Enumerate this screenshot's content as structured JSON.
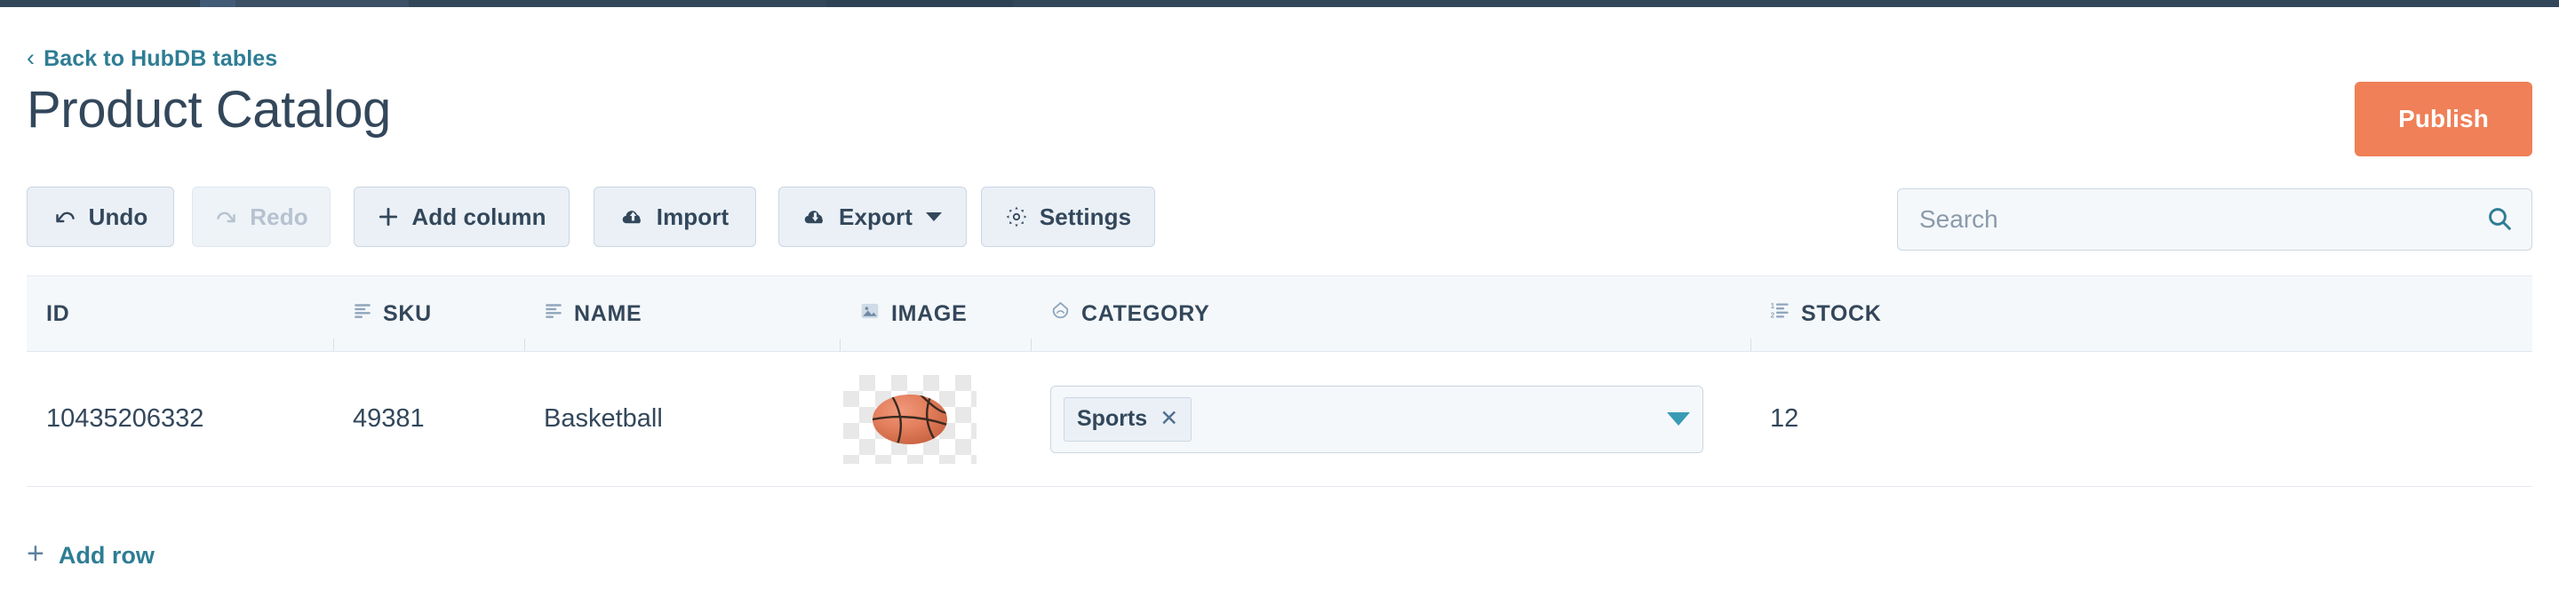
{
  "app": {
    "back_link": "Back to HubDB tables",
    "page_title": "Product Catalog",
    "publish_label": "Publish"
  },
  "colors": {
    "accent_link": "#2e7d94",
    "publish_bg": "#ef8058",
    "text": "#33475b",
    "toolbar_bg": "#eaf0f6",
    "border": "#cbd6e2",
    "header_bg": "#f5f8fa",
    "caret_teal": "#3a9bb5",
    "topnav": "#33475b"
  },
  "toolbar": {
    "buttons": [
      {
        "label": "Undo",
        "icon": "undo-arrow-icon",
        "disabled": false
      },
      {
        "label": "Redo",
        "icon": "redo-arrow-icon",
        "disabled": true
      },
      {
        "label": "Add column",
        "icon": "plus-icon",
        "disabled": false
      },
      {
        "label": "Import",
        "icon": "cloud-upload-icon",
        "disabled": false
      },
      {
        "label": "Export",
        "icon": "cloud-download-icon",
        "disabled": false,
        "has_caret": true
      },
      {
        "label": "Settings",
        "icon": "gear-icon",
        "disabled": false
      }
    ]
  },
  "search": {
    "placeholder": "Search",
    "value": "",
    "icon": "search-icon"
  },
  "table": {
    "columns": [
      {
        "label": "ID",
        "icon": null
      },
      {
        "label": "SKU",
        "icon": "text-lines-icon"
      },
      {
        "label": "NAME",
        "icon": "text-lines-icon"
      },
      {
        "label": "IMAGE",
        "icon": "image-icon"
      },
      {
        "label": "CATEGORY",
        "icon": "multiselect-icon"
      },
      {
        "label": "STOCK",
        "icon": "numbered-list-icon"
      }
    ],
    "rows": [
      {
        "id": "10435206332",
        "sku": "49381",
        "name": "Basketball",
        "image": "basketball-thumbnail",
        "category_tags": [
          "Sports"
        ],
        "tag_remove_glyph": "✕",
        "stock": "12"
      }
    ]
  },
  "footer": {
    "add_row_label": "Add row",
    "add_row_icon": "plus-icon"
  }
}
